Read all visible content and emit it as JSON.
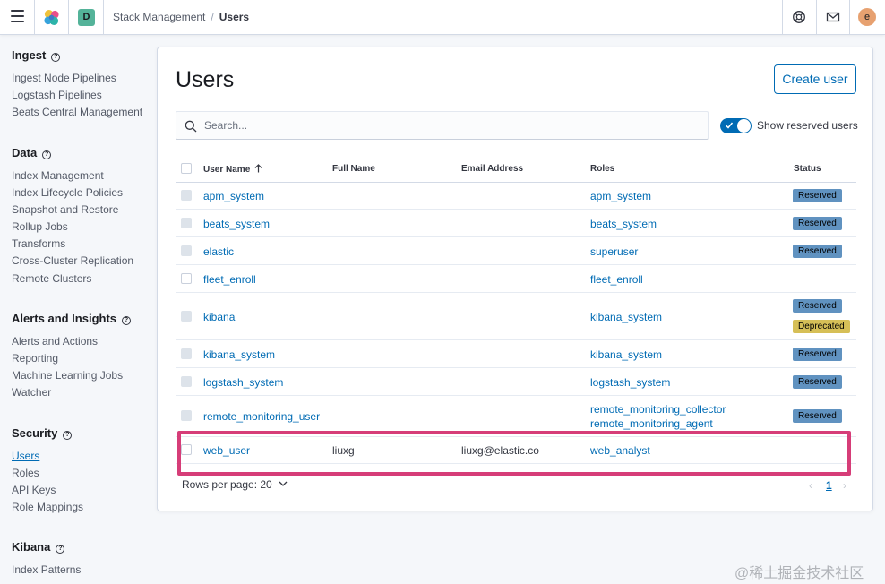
{
  "header": {
    "space_initial": "D",
    "breadcrumb_parent": "Stack Management",
    "breadcrumb_separator": "/",
    "breadcrumb_current": "Users",
    "user_initial": "e"
  },
  "sidebar": {
    "sections": [
      {
        "title": "Ingest",
        "items": [
          "Ingest Node Pipelines",
          "Logstash Pipelines",
          "Beats Central Management"
        ]
      },
      {
        "title": "Data",
        "items": [
          "Index Management",
          "Index Lifecycle Policies",
          "Snapshot and Restore",
          "Rollup Jobs",
          "Transforms",
          "Cross-Cluster Replication",
          "Remote Clusters"
        ]
      },
      {
        "title": "Alerts and Insights",
        "items": [
          "Alerts and Actions",
          "Reporting",
          "Machine Learning Jobs",
          "Watcher"
        ]
      },
      {
        "title": "Security",
        "items": [
          "Users",
          "Roles",
          "API Keys",
          "Role Mappings"
        ]
      },
      {
        "title": "Kibana",
        "items": [
          "Index Patterns"
        ]
      }
    ],
    "help_glyph": "?",
    "active_item": "Users"
  },
  "main": {
    "title": "Users",
    "create_button": "Create user",
    "search_placeholder": "Search...",
    "toggle_label": "Show reserved users",
    "toggle_on": true,
    "columns": [
      "User Name",
      "Full Name",
      "Email Address",
      "Roles",
      "Status"
    ],
    "rows": [
      {
        "username": "apm_system",
        "full_name": "",
        "email": "",
        "roles": [
          "apm_system"
        ],
        "badges": [
          "Reserved"
        ]
      },
      {
        "username": "beats_system",
        "full_name": "",
        "email": "",
        "roles": [
          "beats_system"
        ],
        "badges": [
          "Reserved"
        ]
      },
      {
        "username": "elastic",
        "full_name": "",
        "email": "",
        "roles": [
          "superuser"
        ],
        "badges": [
          "Reserved"
        ]
      },
      {
        "username": "fleet_enroll",
        "full_name": "",
        "email": "",
        "roles": [
          "fleet_enroll"
        ],
        "badges": []
      },
      {
        "username": "kibana",
        "full_name": "",
        "email": "",
        "roles": [
          "kibana_system"
        ],
        "badges": [
          "Reserved",
          "Deprecated"
        ]
      },
      {
        "username": "kibana_system",
        "full_name": "",
        "email": "",
        "roles": [
          "kibana_system"
        ],
        "badges": [
          "Reserved"
        ]
      },
      {
        "username": "logstash_system",
        "full_name": "",
        "email": "",
        "roles": [
          "logstash_system"
        ],
        "badges": [
          "Reserved"
        ]
      },
      {
        "username": "remote_monitoring_user",
        "full_name": "",
        "email": "",
        "roles": [
          "remote_monitoring_collector",
          "remote_monitoring_agent"
        ],
        "badges": [
          "Reserved"
        ]
      },
      {
        "username": "web_user",
        "full_name": "liuxg",
        "email": "liuxg@elastic.co",
        "roles": [
          "web_analyst"
        ],
        "badges": []
      }
    ],
    "rows_per_page_label": "Rows per page: 20",
    "pagination": {
      "prev": "‹",
      "current_page": "1",
      "next": "›"
    }
  },
  "watermark": "@稀土掘金技术社区",
  "colors": {
    "accent": "#006bb4",
    "reserved_badge": "#6092c0",
    "deprecated_badge": "#d6bf57",
    "highlight": "#d63d78"
  }
}
